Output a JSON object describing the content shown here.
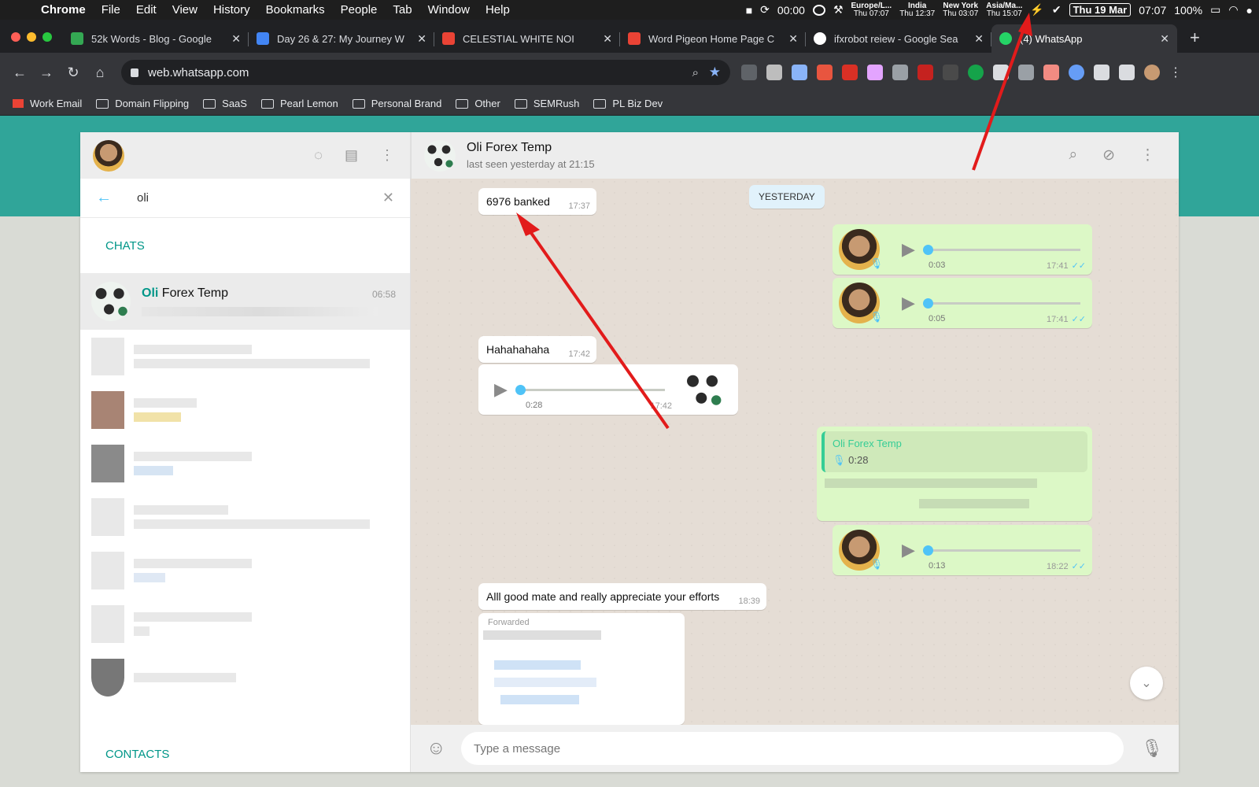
{
  "menubar": {
    "app": "Chrome",
    "menus": [
      "File",
      "Edit",
      "View",
      "History",
      "Bookmarks",
      "People",
      "Tab",
      "Window",
      "Help"
    ],
    "timer": "00:00",
    "clocks": [
      {
        "city": "Europe/L...",
        "time": "Thu 07:07"
      },
      {
        "city": "India",
        "time": "Thu 12:37"
      },
      {
        "city": "New York",
        "time": "Thu 03:07"
      },
      {
        "city": "Asia/Ma...",
        "time": "Thu 15:07"
      }
    ],
    "date": "Thu 19 Mar",
    "time": "07:07",
    "battery": "100%"
  },
  "tabs": [
    {
      "title": "52k Words - Blog - Google",
      "color": "#34a853"
    },
    {
      "title": "Day 26 & 27: My Journey W",
      "color": "#4285f4"
    },
    {
      "title": "CELESTIAL WHITE NOI",
      "color": "#ea4335"
    },
    {
      "title": "Word Pigeon Home Page C",
      "color": "#ea4335"
    },
    {
      "title": "ifxrobot reiew - Google Sea",
      "color": "#ffffff"
    },
    {
      "title": "(4) WhatsApp",
      "color": "#25d366"
    }
  ],
  "address": {
    "url": "web.whatsapp.com"
  },
  "bookmarks": [
    "Work Email",
    "Domain Flipping",
    "SaaS",
    "Pearl Lemon",
    "Personal Brand",
    "Other",
    "SEMRush",
    "PL Biz Dev"
  ],
  "sidebar": {
    "search_value": "oli",
    "chats_label": "CHATS",
    "contacts_label": "CONTACTS",
    "result": {
      "highlight": "Oli",
      "rest": " Forex Temp",
      "time": "06:58"
    }
  },
  "chat": {
    "name": "Oli Forex Temp",
    "status": "last seen yesterday at 21:15",
    "day": "YESTERDAY",
    "msg_banked": {
      "text": "6976 banked",
      "time": "17:37"
    },
    "voice1": {
      "dur": "0:03",
      "time": "17:41"
    },
    "voice2": {
      "dur": "0:05",
      "time": "17:41"
    },
    "msg_haha": {
      "text": "Hahahahaha",
      "time": "17:42"
    },
    "voice_in": {
      "dur": "0:28",
      "time": "17:42"
    },
    "reply_quote": {
      "name": "Oli Forex Temp",
      "dur": "0:28"
    },
    "voice3": {
      "dur": "0:13",
      "time": "18:22"
    },
    "msg_good": {
      "text": "Alll good mate and really appreciate your efforts",
      "time": "18:39"
    },
    "forwarded": "Forwarded",
    "composer_placeholder": "Type a message"
  },
  "colors": {
    "teal": "#009688",
    "outgoing": "#dcf8c6",
    "accent_blue": "#4fc3f7",
    "annotation": "#e21b1b"
  }
}
